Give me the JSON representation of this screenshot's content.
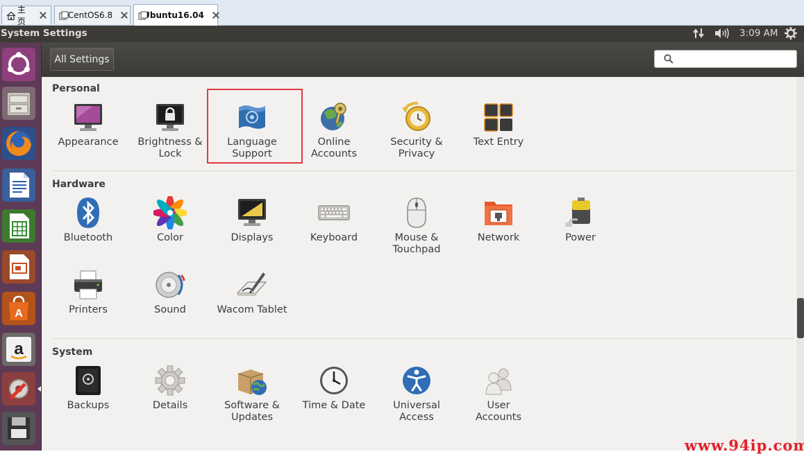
{
  "host_tabs": [
    {
      "label": "主页",
      "icon": "home-icon"
    },
    {
      "label": "CentOS6.8",
      "icon": "vm-icon"
    },
    {
      "label": "Ubuntu16.04",
      "icon": "vm-icon",
      "active": true
    }
  ],
  "topbar": {
    "title": "System Settings",
    "time": "3:09 AM",
    "indicators": [
      "network-arrows-icon",
      "volume-icon",
      "gear-icon"
    ]
  },
  "launcher": [
    "ubuntu-dash-icon",
    "files-icon",
    "firefox-icon",
    "writer-icon",
    "calc-icon",
    "impress-icon",
    "software-center-icon",
    "amazon-icon",
    "system-settings-icon",
    "floppy-icon"
  ],
  "header": {
    "all_settings_label": "All Settings",
    "search_placeholder": "",
    "search_value": ""
  },
  "sections": [
    {
      "title": "Personal",
      "items": [
        {
          "label": "Appearance",
          "icon": "appearance-icon"
        },
        {
          "label": "Brightness &\nLock",
          "icon": "brightness-lock-icon"
        },
        {
          "label": "Language\nSupport",
          "icon": "language-support-icon"
        },
        {
          "label": "Online\nAccounts",
          "icon": "online-accounts-icon"
        },
        {
          "label": "Security &\nPrivacy",
          "icon": "security-privacy-icon"
        },
        {
          "label": "Text Entry",
          "icon": "text-entry-icon"
        }
      ]
    },
    {
      "title": "Hardware",
      "items": [
        {
          "label": "Bluetooth",
          "icon": "bluetooth-icon"
        },
        {
          "label": "Color",
          "icon": "color-icon"
        },
        {
          "label": "Displays",
          "icon": "displays-icon"
        },
        {
          "label": "Keyboard",
          "icon": "keyboard-icon"
        },
        {
          "label": "Mouse &\nTouchpad",
          "icon": "mouse-touchpad-icon"
        },
        {
          "label": "Network",
          "icon": "network-icon"
        },
        {
          "label": "Power",
          "icon": "power-icon"
        },
        {
          "label": "Printers",
          "icon": "printers-icon"
        },
        {
          "label": "Sound",
          "icon": "sound-icon"
        },
        {
          "label": "Wacom Tablet",
          "icon": "wacom-tablet-icon"
        }
      ]
    },
    {
      "title": "System",
      "items": [
        {
          "label": "Backups",
          "icon": "backups-icon"
        },
        {
          "label": "Details",
          "icon": "details-icon"
        },
        {
          "label": "Software &\nUpdates",
          "icon": "software-updates-icon"
        },
        {
          "label": "Time & Date",
          "icon": "time-date-icon"
        },
        {
          "label": "Universal\nAccess",
          "icon": "universal-access-icon"
        },
        {
          "label": "User\nAccounts",
          "icon": "user-accounts-icon"
        }
      ]
    }
  ],
  "highlighted_item": "Language\nSupport",
  "colors": {
    "highlight": "#e0393e",
    "launcher": "#5d3a55",
    "panel": "#3c3b37",
    "content": "#f2f1f0"
  },
  "watermark": "www.94ip.com"
}
